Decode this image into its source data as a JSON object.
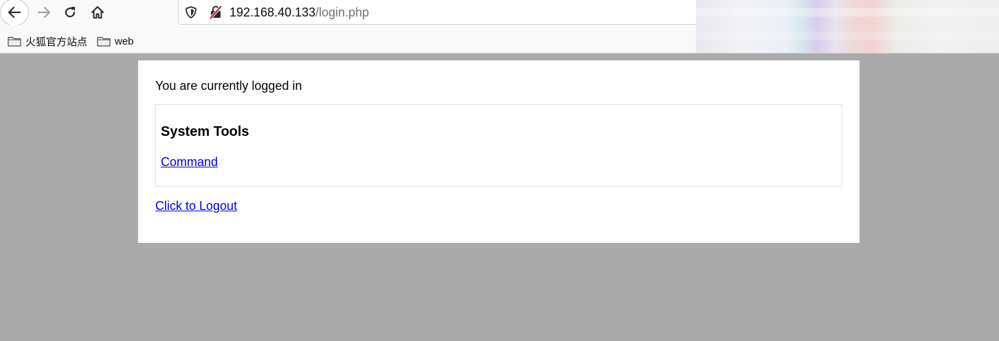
{
  "browser": {
    "url_host": "192.168.40.133",
    "url_path": "/login.php",
    "bookmarks": [
      {
        "label": "火狐官方站点",
        "icon": "folder-icon"
      },
      {
        "label": "web",
        "icon": "folder-icon"
      }
    ],
    "icons": {
      "back": "back-arrow-icon",
      "forward": "forward-arrow-icon",
      "reload": "reload-icon",
      "home": "home-icon",
      "tracking": "shield-icon",
      "security": "insecure-lock-icon"
    }
  },
  "page": {
    "status_text": "You are currently logged in",
    "tools_heading": "System Tools",
    "command_link": "Command",
    "logout_link": "Click to Logout"
  },
  "colors": {
    "page_background": "#aaaaaa",
    "panel_background": "#ffffff",
    "link": "#0000ee",
    "insecure_lock": "#d70022"
  }
}
